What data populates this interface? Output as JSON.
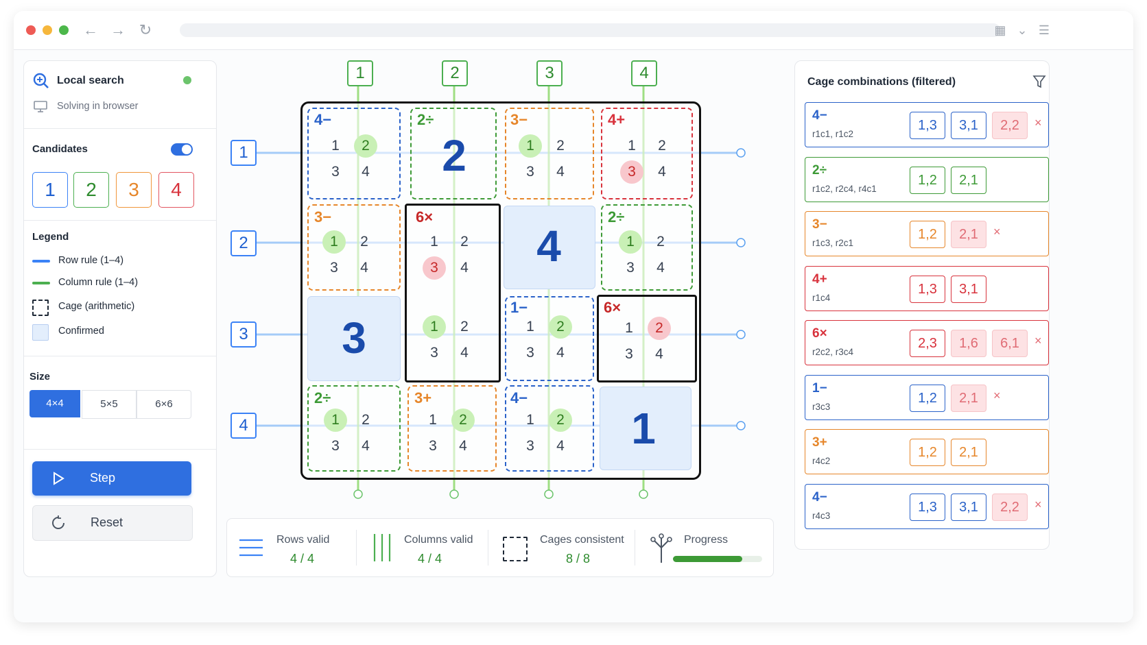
{
  "left_panel": {
    "title": "Local search",
    "subtitle": "Solving in browser",
    "candidates_label": "Candidates",
    "candidates": [
      "1",
      "2",
      "3",
      "4"
    ],
    "legend_title": "Legend",
    "legend": [
      "Row rule (1–4)",
      "Column rule (1–4)",
      "Cage (arithmetic)",
      "Confirmed"
    ],
    "size_label": "Size",
    "sizes": [
      "4×4",
      "5×5",
      "6×6"
    ],
    "step_label": "Step",
    "reset_label": "Reset"
  },
  "grid": {
    "col_tags": [
      "1",
      "2",
      "3",
      "4"
    ],
    "row_tags": [
      "1",
      "2",
      "3",
      "4"
    ],
    "cages": [
      {
        "label": "4−",
        "color": "#2a62c9"
      },
      {
        "label": "2÷",
        "color": "#3d9a36"
      },
      {
        "label": "3−",
        "color": "#e6862a"
      },
      {
        "label": "4+",
        "color": "#d8323c"
      },
      {
        "label": "3−",
        "color": "#e6862a"
      },
      {
        "label": "6×",
        "color": "#c62828"
      },
      {
        "label": "2÷",
        "color": "#3d9a36"
      },
      {
        "label": "1−",
        "color": "#2a62c9"
      },
      {
        "label": "6×",
        "color": "#c62828"
      },
      {
        "label": "2÷",
        "color": "#3d9a36"
      },
      {
        "label": "3+",
        "color": "#e6862a"
      },
      {
        "label": "4−",
        "color": "#2a62c9"
      }
    ],
    "confirmed": [
      "2",
      "4",
      "3",
      "1"
    ],
    "cand_digits": [
      "1",
      "2",
      "3",
      "4"
    ]
  },
  "right_panel": {
    "title": "Cage combinations (filtered)",
    "combos": [
      {
        "label": "4−",
        "cells": "r1c1, r1c2",
        "color": "#2a62c9",
        "chips": [
          "1,3",
          "3,1",
          "2,2"
        ],
        "bad": [
          false,
          false,
          true
        ],
        "x": true
      },
      {
        "label": "2÷",
        "cells": "r1c2, r2c4, r4c1",
        "color": "#3d9a36",
        "chips": [
          "1,2",
          "2,1"
        ],
        "bad": [
          false,
          false
        ],
        "x": false
      },
      {
        "label": "3−",
        "cells": "r1c3, r2c1",
        "color": "#e6862a",
        "chips": [
          "1,2",
          "2,1"
        ],
        "bad": [
          false,
          true
        ],
        "x": true
      },
      {
        "label": "4+",
        "cells": "r1c4",
        "color": "#d8323c",
        "chips": [
          "1,3",
          "3,1"
        ],
        "bad": [
          false,
          false
        ],
        "x": false
      },
      {
        "label": "6×",
        "cells": "r2c2, r3c4",
        "color": "#d8323c",
        "chips": [
          "2,3",
          "1,6",
          "6,1"
        ],
        "bad": [
          false,
          true,
          true
        ],
        "x": true
      },
      {
        "label": "1−",
        "cells": "r3c3",
        "color": "#2a62c9",
        "chips": [
          "1,2",
          "2,1"
        ],
        "bad": [
          false,
          true
        ],
        "x": true
      },
      {
        "label": "3+",
        "cells": "r4c2",
        "color": "#e6862a",
        "chips": [
          "1,2",
          "2,1"
        ],
        "bad": [
          false,
          false
        ],
        "x": false
      },
      {
        "label": "4−",
        "cells": "r4c3",
        "color": "#2a62c9",
        "chips": [
          "1,3",
          "3,1",
          "2,2"
        ],
        "bad": [
          false,
          false,
          true
        ],
        "x": true
      }
    ]
  },
  "stats": {
    "rows_label": "Rows valid",
    "rows_value": "4 / 4",
    "cols_label": "Columns valid",
    "cols_value": "4 / 4",
    "cages_label": "Cages consistent",
    "cages_value": "8 / 8",
    "progress_label": "Progress",
    "progress_fraction": 0.78
  },
  "colors": {
    "accent": "#2f6fe0",
    "row": "#3b82f6",
    "col": "#4caf50",
    "confirmed_bg": "#e3eefc"
  }
}
